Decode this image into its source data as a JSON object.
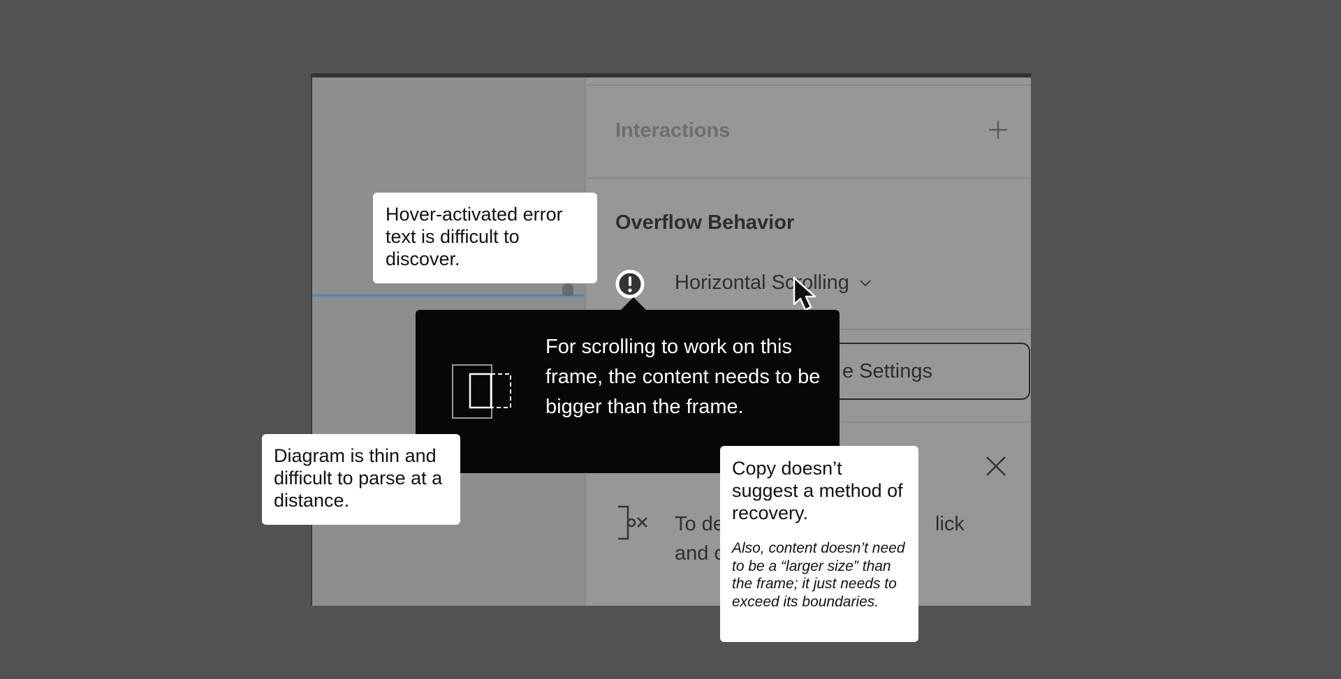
{
  "panel": {
    "interactions_label": "Interactions",
    "overflow_label": "Overflow Behavior",
    "scroll_value": "Horizontal Scrolling",
    "settings_button_label": "e Settings",
    "detach_text_line1_start": "To de",
    "detach_text_line1_end": "lick",
    "detach_text_line2_start": "and c"
  },
  "tooltip": {
    "text": "For scrolling to work on this frame, the content needs to be bigger than the frame."
  },
  "callouts": {
    "hover": "Hover-activated error text is difficult to discover.",
    "diagram": "Diagram is thin and difficult to parse at a distance.",
    "copy": "Copy doesn’t suggest a method of recovery.",
    "copy_note": "Also, content doesn’t need to be a “larger size” than the frame; it just needs to exceed its boundaries."
  },
  "icons": {
    "plus": "plus-icon",
    "warning": "warning-icon",
    "chevron": "chevron-down-icon",
    "close": "close-icon",
    "detach": "detach-icon",
    "cursor": "cursor-icon",
    "diagram": "frame-overflow-diagram-icon"
  },
  "colors": {
    "background": "#525252",
    "canvas_selection": "#4d86b8",
    "tooltip": "#070707",
    "callout": "#ffffff"
  }
}
